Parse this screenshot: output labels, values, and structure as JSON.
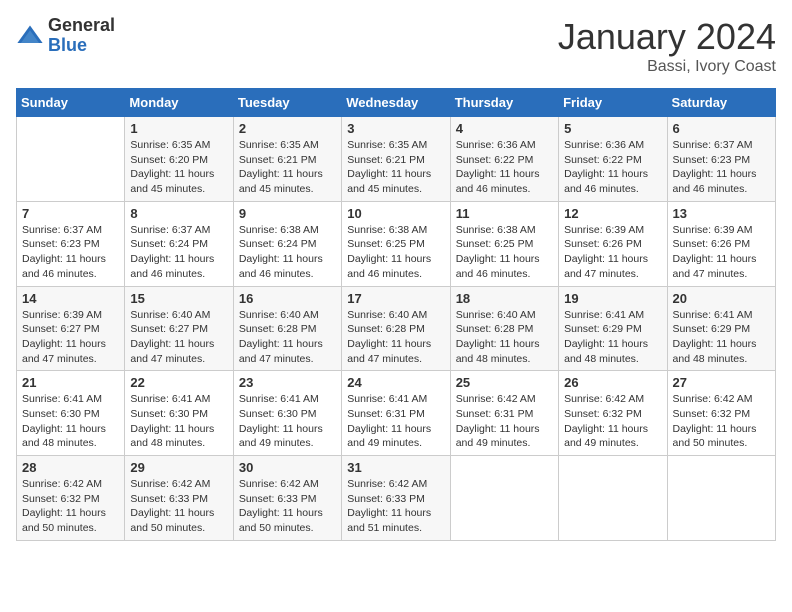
{
  "logo": {
    "general": "General",
    "blue": "Blue"
  },
  "title": "January 2024",
  "location": "Bassi, Ivory Coast",
  "days_of_week": [
    "Sunday",
    "Monday",
    "Tuesday",
    "Wednesday",
    "Thursday",
    "Friday",
    "Saturday"
  ],
  "weeks": [
    [
      {
        "day": "",
        "info": ""
      },
      {
        "day": "1",
        "info": "Sunrise: 6:35 AM\nSunset: 6:20 PM\nDaylight: 11 hours and 45 minutes."
      },
      {
        "day": "2",
        "info": "Sunrise: 6:35 AM\nSunset: 6:21 PM\nDaylight: 11 hours and 45 minutes."
      },
      {
        "day": "3",
        "info": "Sunrise: 6:35 AM\nSunset: 6:21 PM\nDaylight: 11 hours and 45 minutes."
      },
      {
        "day": "4",
        "info": "Sunrise: 6:36 AM\nSunset: 6:22 PM\nDaylight: 11 hours and 46 minutes."
      },
      {
        "day": "5",
        "info": "Sunrise: 6:36 AM\nSunset: 6:22 PM\nDaylight: 11 hours and 46 minutes."
      },
      {
        "day": "6",
        "info": "Sunrise: 6:37 AM\nSunset: 6:23 PM\nDaylight: 11 hours and 46 minutes."
      }
    ],
    [
      {
        "day": "7",
        "info": "Sunrise: 6:37 AM\nSunset: 6:23 PM\nDaylight: 11 hours and 46 minutes."
      },
      {
        "day": "8",
        "info": "Sunrise: 6:37 AM\nSunset: 6:24 PM\nDaylight: 11 hours and 46 minutes."
      },
      {
        "day": "9",
        "info": "Sunrise: 6:38 AM\nSunset: 6:24 PM\nDaylight: 11 hours and 46 minutes."
      },
      {
        "day": "10",
        "info": "Sunrise: 6:38 AM\nSunset: 6:25 PM\nDaylight: 11 hours and 46 minutes."
      },
      {
        "day": "11",
        "info": "Sunrise: 6:38 AM\nSunset: 6:25 PM\nDaylight: 11 hours and 46 minutes."
      },
      {
        "day": "12",
        "info": "Sunrise: 6:39 AM\nSunset: 6:26 PM\nDaylight: 11 hours and 47 minutes."
      },
      {
        "day": "13",
        "info": "Sunrise: 6:39 AM\nSunset: 6:26 PM\nDaylight: 11 hours and 47 minutes."
      }
    ],
    [
      {
        "day": "14",
        "info": "Sunrise: 6:39 AM\nSunset: 6:27 PM\nDaylight: 11 hours and 47 minutes."
      },
      {
        "day": "15",
        "info": "Sunrise: 6:40 AM\nSunset: 6:27 PM\nDaylight: 11 hours and 47 minutes."
      },
      {
        "day": "16",
        "info": "Sunrise: 6:40 AM\nSunset: 6:28 PM\nDaylight: 11 hours and 47 minutes."
      },
      {
        "day": "17",
        "info": "Sunrise: 6:40 AM\nSunset: 6:28 PM\nDaylight: 11 hours and 47 minutes."
      },
      {
        "day": "18",
        "info": "Sunrise: 6:40 AM\nSunset: 6:28 PM\nDaylight: 11 hours and 48 minutes."
      },
      {
        "day": "19",
        "info": "Sunrise: 6:41 AM\nSunset: 6:29 PM\nDaylight: 11 hours and 48 minutes."
      },
      {
        "day": "20",
        "info": "Sunrise: 6:41 AM\nSunset: 6:29 PM\nDaylight: 11 hours and 48 minutes."
      }
    ],
    [
      {
        "day": "21",
        "info": "Sunrise: 6:41 AM\nSunset: 6:30 PM\nDaylight: 11 hours and 48 minutes."
      },
      {
        "day": "22",
        "info": "Sunrise: 6:41 AM\nSunset: 6:30 PM\nDaylight: 11 hours and 48 minutes."
      },
      {
        "day": "23",
        "info": "Sunrise: 6:41 AM\nSunset: 6:30 PM\nDaylight: 11 hours and 49 minutes."
      },
      {
        "day": "24",
        "info": "Sunrise: 6:41 AM\nSunset: 6:31 PM\nDaylight: 11 hours and 49 minutes."
      },
      {
        "day": "25",
        "info": "Sunrise: 6:42 AM\nSunset: 6:31 PM\nDaylight: 11 hours and 49 minutes."
      },
      {
        "day": "26",
        "info": "Sunrise: 6:42 AM\nSunset: 6:32 PM\nDaylight: 11 hours and 49 minutes."
      },
      {
        "day": "27",
        "info": "Sunrise: 6:42 AM\nSunset: 6:32 PM\nDaylight: 11 hours and 50 minutes."
      }
    ],
    [
      {
        "day": "28",
        "info": "Sunrise: 6:42 AM\nSunset: 6:32 PM\nDaylight: 11 hours and 50 minutes."
      },
      {
        "day": "29",
        "info": "Sunrise: 6:42 AM\nSunset: 6:33 PM\nDaylight: 11 hours and 50 minutes."
      },
      {
        "day": "30",
        "info": "Sunrise: 6:42 AM\nSunset: 6:33 PM\nDaylight: 11 hours and 50 minutes."
      },
      {
        "day": "31",
        "info": "Sunrise: 6:42 AM\nSunset: 6:33 PM\nDaylight: 11 hours and 51 minutes."
      },
      {
        "day": "",
        "info": ""
      },
      {
        "day": "",
        "info": ""
      },
      {
        "day": "",
        "info": ""
      }
    ]
  ]
}
